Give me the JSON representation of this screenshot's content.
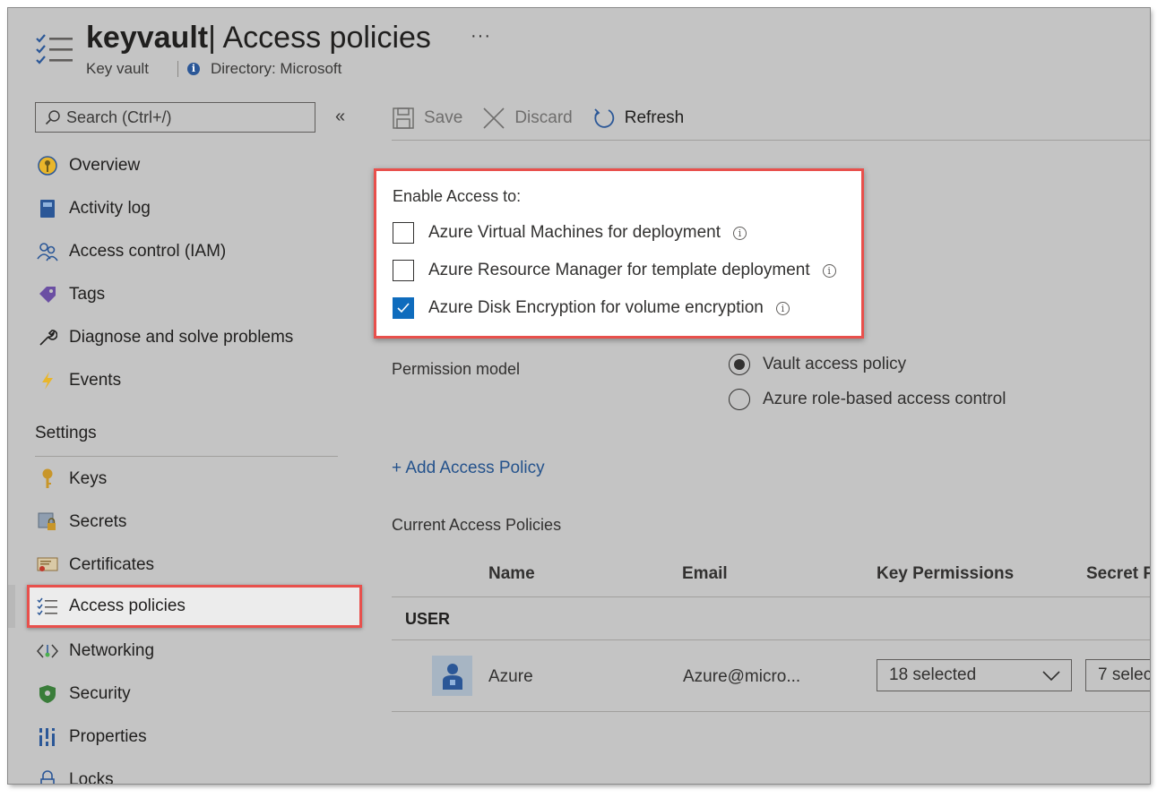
{
  "header": {
    "resource_name": "keyvault",
    "page_title": "| Access policies",
    "more": "···",
    "resource_type": "Key vault",
    "directory": "Directory: Microsoft"
  },
  "sidebar": {
    "search_placeholder": "Search (Ctrl+/)",
    "collapse": "«",
    "items": [
      {
        "label": "Overview",
        "icon": "overview-icon"
      },
      {
        "label": "Activity log",
        "icon": "activity-log-icon"
      },
      {
        "label": "Access control (IAM)",
        "icon": "people-icon"
      },
      {
        "label": "Tags",
        "icon": "tag-icon"
      },
      {
        "label": "Diagnose and solve problems",
        "icon": "wrench-icon"
      },
      {
        "label": "Events",
        "icon": "lightning-icon"
      }
    ],
    "settings_label": "Settings",
    "settings_items": [
      {
        "label": "Keys",
        "icon": "key-icon"
      },
      {
        "label": "Secrets",
        "icon": "secret-icon"
      },
      {
        "label": "Certificates",
        "icon": "certificate-icon"
      },
      {
        "label": "Access policies",
        "icon": "checklist-icon"
      },
      {
        "label": "Networking",
        "icon": "networking-icon"
      },
      {
        "label": "Security",
        "icon": "shield-icon"
      },
      {
        "label": "Properties",
        "icon": "properties-icon"
      },
      {
        "label": "Locks",
        "icon": "lock-icon"
      }
    ]
  },
  "toolbar": {
    "save": "Save",
    "discard": "Discard",
    "refresh": "Refresh"
  },
  "enable_access": {
    "title": "Enable Access to:",
    "options": [
      {
        "label": "Azure Virtual Machines for deployment",
        "checked": false
      },
      {
        "label": "Azure Resource Manager for template deployment",
        "checked": false
      },
      {
        "label": "Azure Disk Encryption for volume encryption",
        "checked": true
      }
    ]
  },
  "permission_model": {
    "label": "Permission model",
    "options": [
      {
        "label": "Vault access policy",
        "selected": true
      },
      {
        "label": "Azure role-based access control",
        "selected": false
      }
    ]
  },
  "add_policy": "+ Add Access Policy",
  "policies": {
    "label": "Current Access Policies",
    "columns": [
      "Name",
      "Email",
      "Key Permissions",
      "Secret P"
    ],
    "group": "USER",
    "rows": [
      {
        "name": "Azure",
        "email": "Azure@micro...",
        "key_permissions": "18 selected",
        "secret_permissions": "7 selec"
      }
    ]
  },
  "colors": {
    "highlight_border": "#e8504c",
    "checkbox_blue": "#0f6cbd",
    "link_blue": "#24528c"
  }
}
